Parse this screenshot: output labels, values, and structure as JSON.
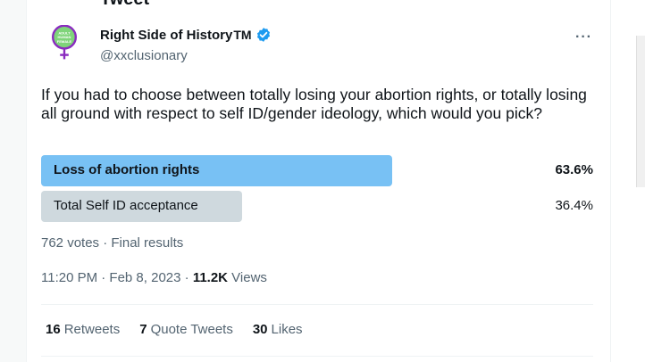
{
  "header": {
    "cut_title": "Tweet"
  },
  "author": {
    "name": "Right Side of History",
    "name_suffix": "TM",
    "handle": "@xxclusionary",
    "avatar_text": [
      "ADULT",
      "HUMAN",
      "FEMALE"
    ],
    "avatar_color": "#8a2bbf",
    "verified_color": "#1d9bf0"
  },
  "more_icon": "···",
  "tweet": {
    "text": "If you had to choose between totally losing your abortion rights, or totally losing all ground with respect to self ID/gender ideology, which would you pick?"
  },
  "poll": {
    "options": [
      {
        "label": "Loss of abortion rights",
        "percent_text": "63.6%",
        "percent": 63.6,
        "winner": true,
        "color": "#78c1f4"
      },
      {
        "label": "Total Self ID acceptance",
        "percent_text": "36.4%",
        "percent": 36.4,
        "winner": false,
        "color": "#cfd9de"
      }
    ],
    "summary": "762 votes · Final results"
  },
  "meta": {
    "time": "11:20 PM · Feb 8, 2023 · ",
    "views_count": "11.2K",
    "views_label": " Views"
  },
  "stats": {
    "retweets_count": "16",
    "retweets_label": "Retweets",
    "quotes_count": "7",
    "quotes_label": "Quote Tweets",
    "likes_count": "30",
    "likes_label": "Likes"
  }
}
